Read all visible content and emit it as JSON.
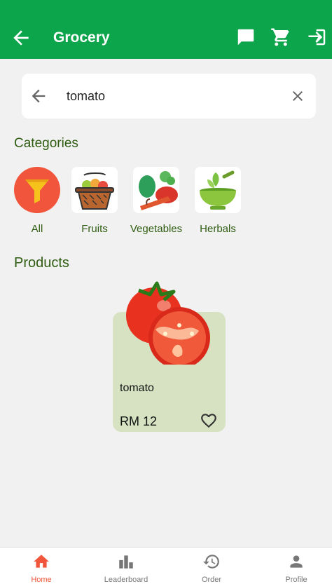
{
  "appbar": {
    "title": "Grocery",
    "back_icon": "arrow-left-icon",
    "actions": [
      "chat-icon",
      "cart-icon",
      "logout-icon"
    ]
  },
  "search": {
    "value": "tomato",
    "back_icon": "arrow-left-icon",
    "clear_icon": "close-icon"
  },
  "categories": {
    "title": "Categories",
    "items": [
      {
        "label": "All",
        "icon": "funnel-icon"
      },
      {
        "label": "Fruits",
        "icon": "fruit-basket-icon"
      },
      {
        "label": "Vegetables",
        "icon": "vegetables-icon"
      },
      {
        "label": "Herbals",
        "icon": "herbal-bowl-icon"
      }
    ]
  },
  "products": {
    "title": "Products",
    "items": [
      {
        "name": "tomato",
        "price": "RM 12",
        "image": "tomato-image",
        "favorite_icon": "heart-outline-icon"
      }
    ]
  },
  "bottom_nav": {
    "items": [
      {
        "label": "Home",
        "icon": "home-icon",
        "active": true
      },
      {
        "label": "Leaderboard",
        "icon": "leaderboard-icon",
        "active": false
      },
      {
        "label": "Order",
        "icon": "history-icon",
        "active": false
      },
      {
        "label": "Profile",
        "icon": "person-icon",
        "active": false
      }
    ]
  },
  "colors": {
    "primary": "#0da54b",
    "active_nav": "#f1553b",
    "category_text": "#2f5d12",
    "card_bg": "#d6e2c2"
  }
}
